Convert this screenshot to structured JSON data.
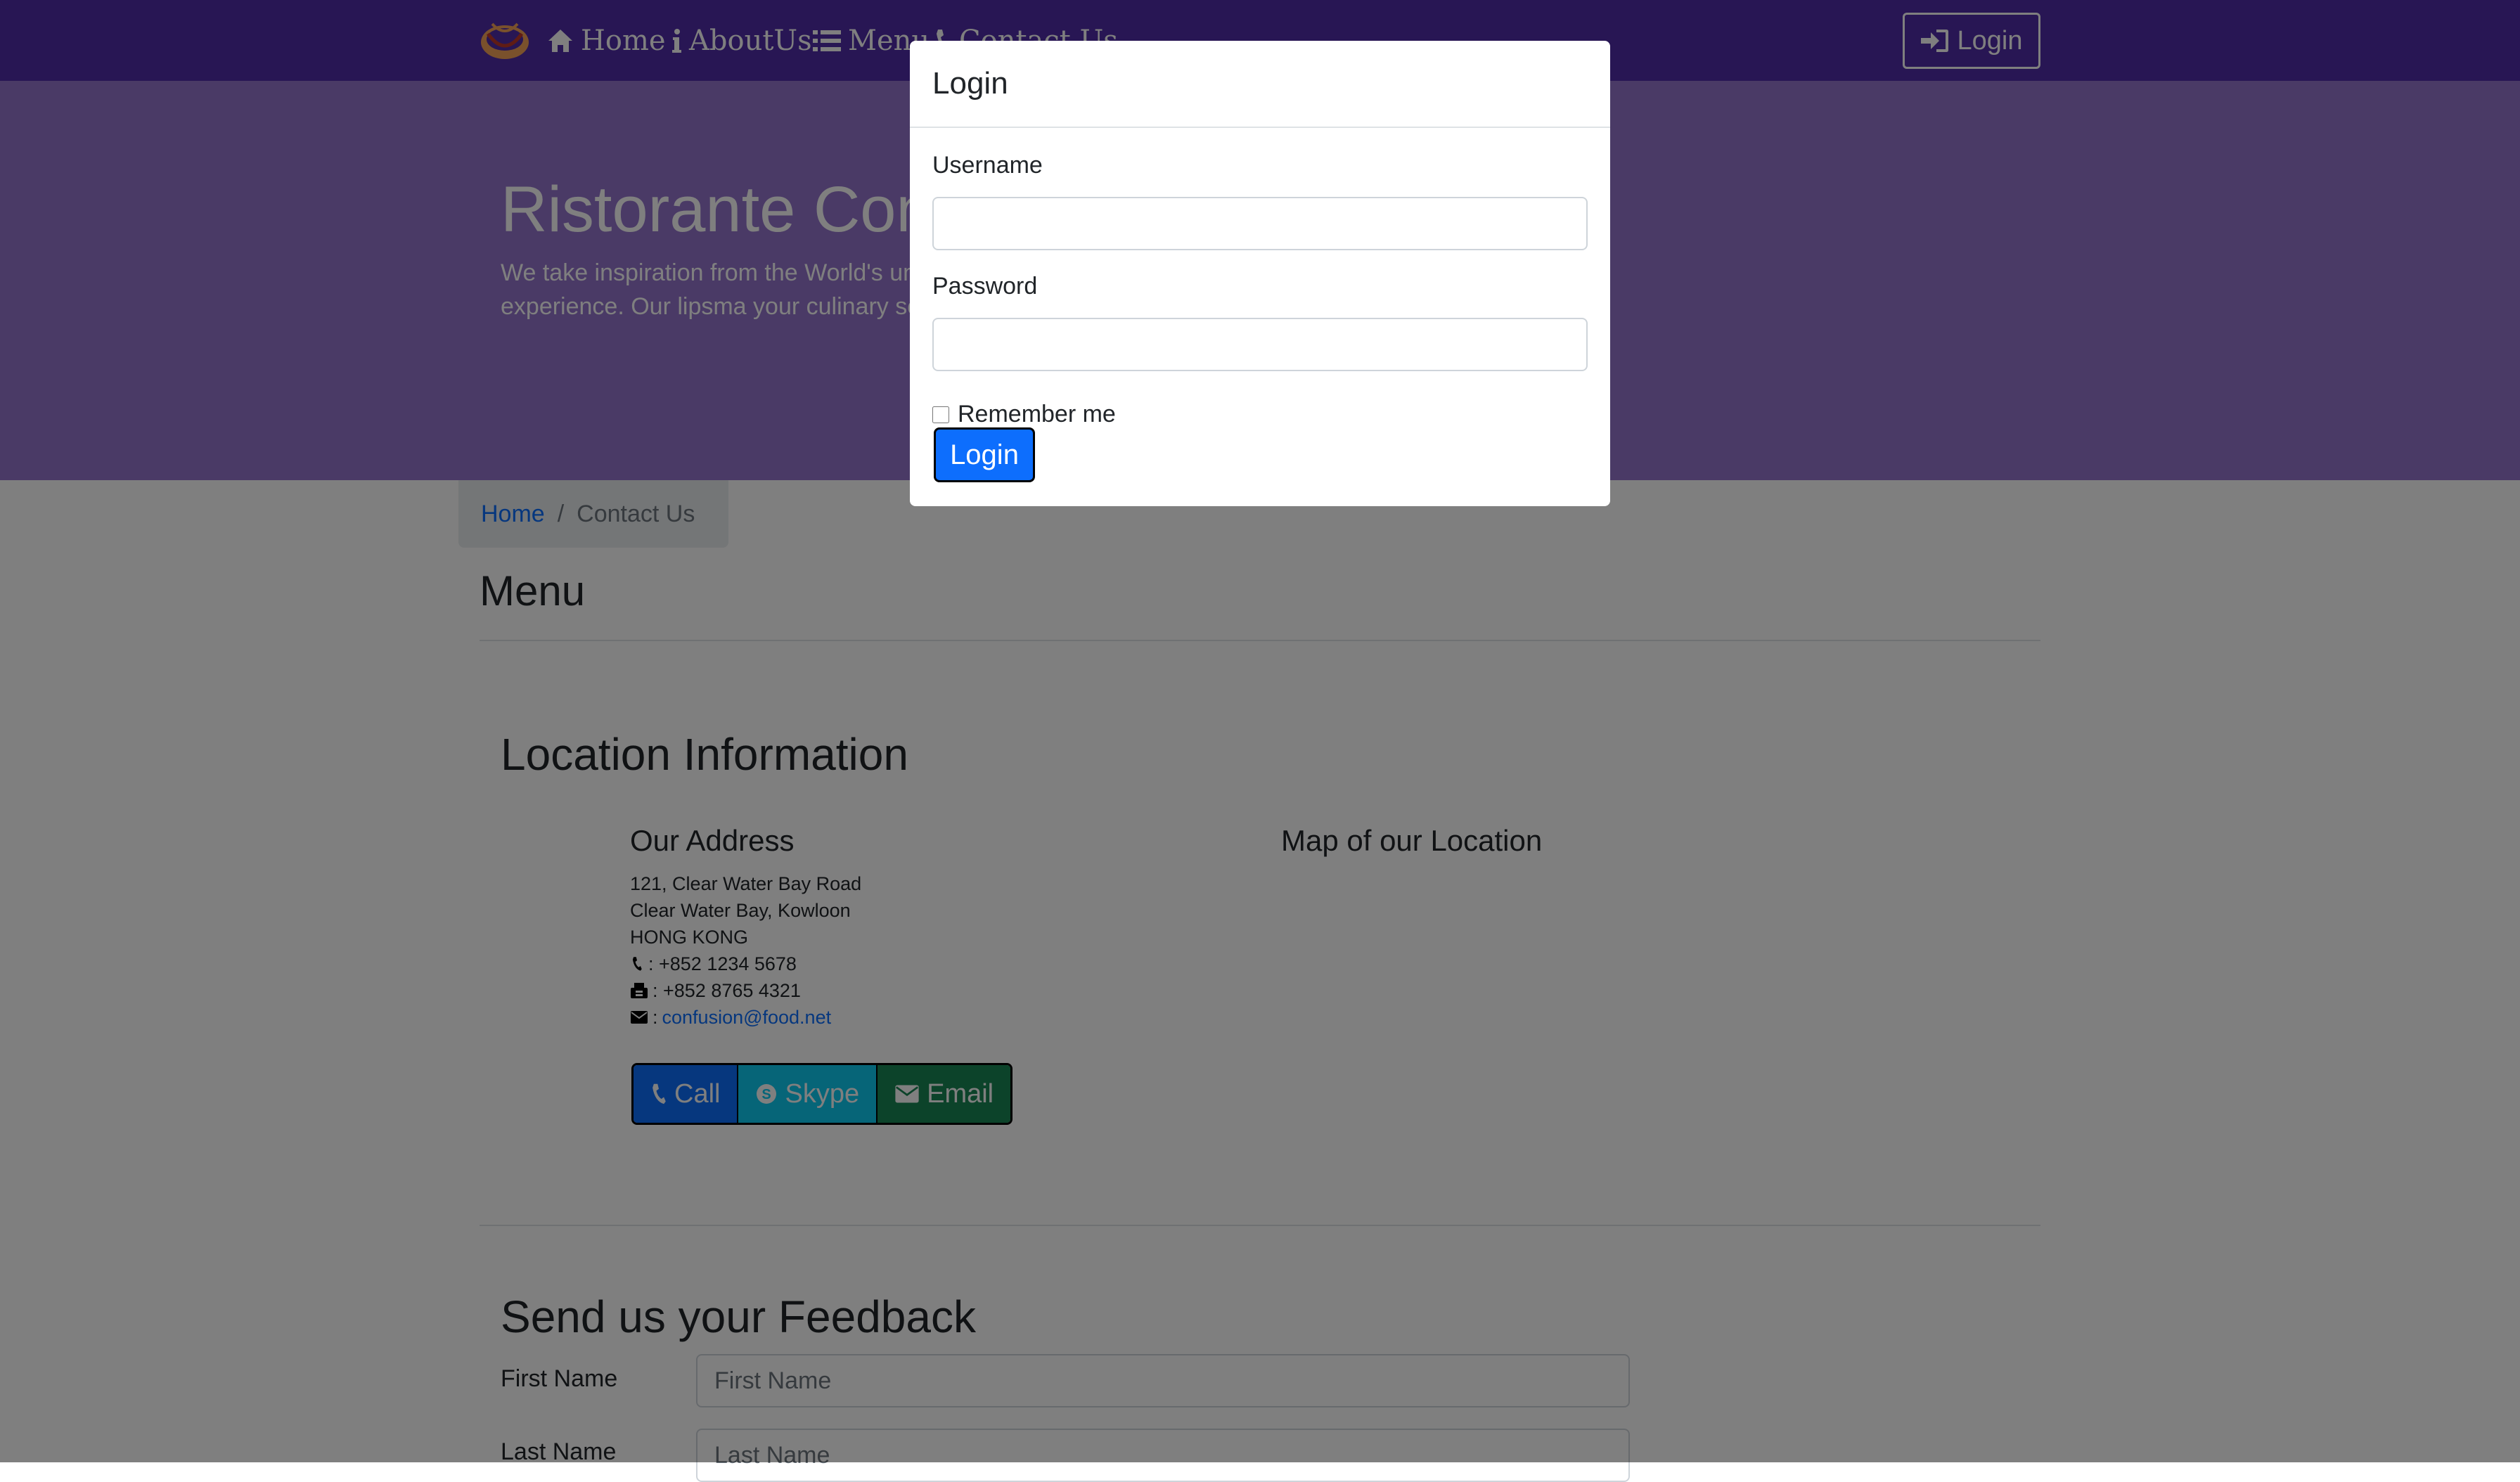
{
  "navbar": {
    "brand_logo": "restaurant-logo",
    "links": [
      {
        "label": "Home",
        "icon": "home-icon"
      },
      {
        "label": "AboutUs",
        "icon": "info-icon"
      },
      {
        "label": "Menu",
        "icon": "list-icon"
      },
      {
        "label": "Contact Us",
        "icon": "phone-icon"
      }
    ],
    "login_label": "Login"
  },
  "jumbotron": {
    "title": "Ristorante Con",
    "text": "We take inspiration from the World's unique fusion experience. Our lipsma your culinary senses!"
  },
  "breadcrumb": {
    "home": "Home",
    "current": "Contact Us"
  },
  "main": {
    "menu_heading": "Menu",
    "location_heading": "Location Information",
    "address_heading": "Our Address",
    "map_heading": "Map of our Location",
    "address_lines": [
      "121, Clear Water Bay Road",
      "Clear Water Bay, Kowloon",
      "HONG KONG"
    ],
    "phone": ": +852 1234 5678",
    "fax": ": +852 8765 4321",
    "email_prefix": ":",
    "email": "confusion@food.net",
    "buttons": {
      "call": "Call",
      "skype": "Skype",
      "email": "Email"
    },
    "feedback_heading": "Send us your Feedback",
    "feedback_form": {
      "first_name_label": "First Name",
      "first_name_placeholder": "First Name",
      "last_name_label": "Last Name",
      "last_name_placeholder": "Last Name"
    }
  },
  "modal": {
    "title": "Login",
    "username_label": "Username",
    "username_value": "",
    "password_label": "Password",
    "password_value": "",
    "remember_label": "Remember me",
    "remember_checked": false,
    "submit_label": "Login"
  },
  "colors": {
    "navbar": "#512da8",
    "jumbotron": "#9575cd",
    "primary": "#0d6efd",
    "info": "#0dcaf0",
    "success": "#198754",
    "overlay": "rgba(0,0,0,0.5)"
  }
}
